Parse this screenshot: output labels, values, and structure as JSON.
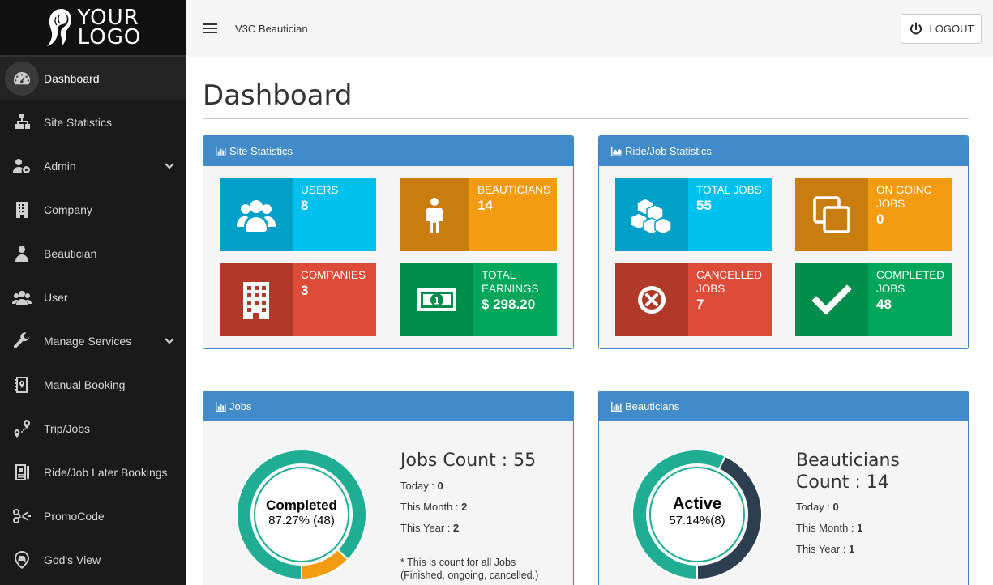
{
  "brand": {
    "logo_line1": "YOUR",
    "logo_line2": "LOGO"
  },
  "sidebar": {
    "items": [
      {
        "label": "Dashboard",
        "icon": "dashboard-icon",
        "active": true
      },
      {
        "label": "Site Statistics",
        "icon": "sitemap-icon"
      },
      {
        "label": "Admin",
        "icon": "users-cog-icon",
        "has_children": true
      },
      {
        "label": "Company",
        "icon": "building-icon"
      },
      {
        "label": "Beautician",
        "icon": "beautician-icon"
      },
      {
        "label": "User",
        "icon": "user-group-icon"
      },
      {
        "label": "Manage Services",
        "icon": "wrench-icon",
        "has_children": true
      },
      {
        "label": "Manual Booking",
        "icon": "booking-book-icon"
      },
      {
        "label": "Trip/Jobs",
        "icon": "route-pin-icon"
      },
      {
        "label": "Ride/Job Later Bookings",
        "icon": "later-booking-icon"
      },
      {
        "label": "PromoCode",
        "icon": "scissors-icon"
      },
      {
        "label": "God's View",
        "icon": "car-pin-icon"
      }
    ]
  },
  "topbar": {
    "title": "V3C  Beautician",
    "logout_label": "LOGOUT"
  },
  "page": {
    "title": "Dashboard"
  },
  "site_stats": {
    "title": "Site Statistics",
    "tiles": [
      {
        "label": "USERS",
        "value": "8",
        "color": "#00c0ef"
      },
      {
        "label": "BEAUTICIANS",
        "value": "14",
        "color": "#f39c12"
      },
      {
        "label": "COMPANIES",
        "value": "3",
        "color": "#dd4b39"
      },
      {
        "label": "TOTAL EARNINGS",
        "value": "$ 298.20",
        "color": "#00a65a"
      }
    ]
  },
  "job_stats": {
    "title": "Ride/Job Statistics",
    "tiles": [
      {
        "label": "TOTAL JOBS",
        "value": "55",
        "color": "#00c0ef"
      },
      {
        "label": "ON GOING JOBS",
        "value": "0",
        "color": "#f39c12"
      },
      {
        "label": "CANCELLED JOBS",
        "value": "7",
        "color": "#dd4b39"
      },
      {
        "label": "COMPLETED JOBS",
        "value": "48",
        "color": "#00a65a"
      }
    ]
  },
  "jobs_panel": {
    "title": "Jobs",
    "count_title": "Jobs Count : 55",
    "today_label": "Today : ",
    "today_value": "0",
    "month_label": "This Month : ",
    "month_value": "2",
    "year_label": "This Year : ",
    "year_value": "2",
    "note_line1": "* This is count for all Jobs",
    "note_line2": "(Finished, ongoing, cancelled.)",
    "donut": {
      "title": "Completed",
      "subtitle": "87.27% (48)",
      "completed_fraction": 0.8727,
      "completed_color": "#1fae94",
      "other_color": "#f39c12"
    }
  },
  "beauticians_panel": {
    "title": "Beauticians",
    "count_title_line1": "Beauticians",
    "count_title_line2": "Count : 14",
    "today_label": "Today : ",
    "today_value": "0",
    "month_label": "This Month : ",
    "month_value": "1",
    "year_label": "This Year : ",
    "year_value": "1",
    "donut": {
      "title": "Active",
      "subtitle": "57.14%(8)",
      "active_fraction": 0.5714,
      "active_color": "#1fae94",
      "inactive_color": "#2c3e50"
    }
  },
  "colors": {
    "sidebar_bg": "#1a1a1a",
    "panel_header": "#428bca",
    "accent_teal": "#1fae94"
  }
}
